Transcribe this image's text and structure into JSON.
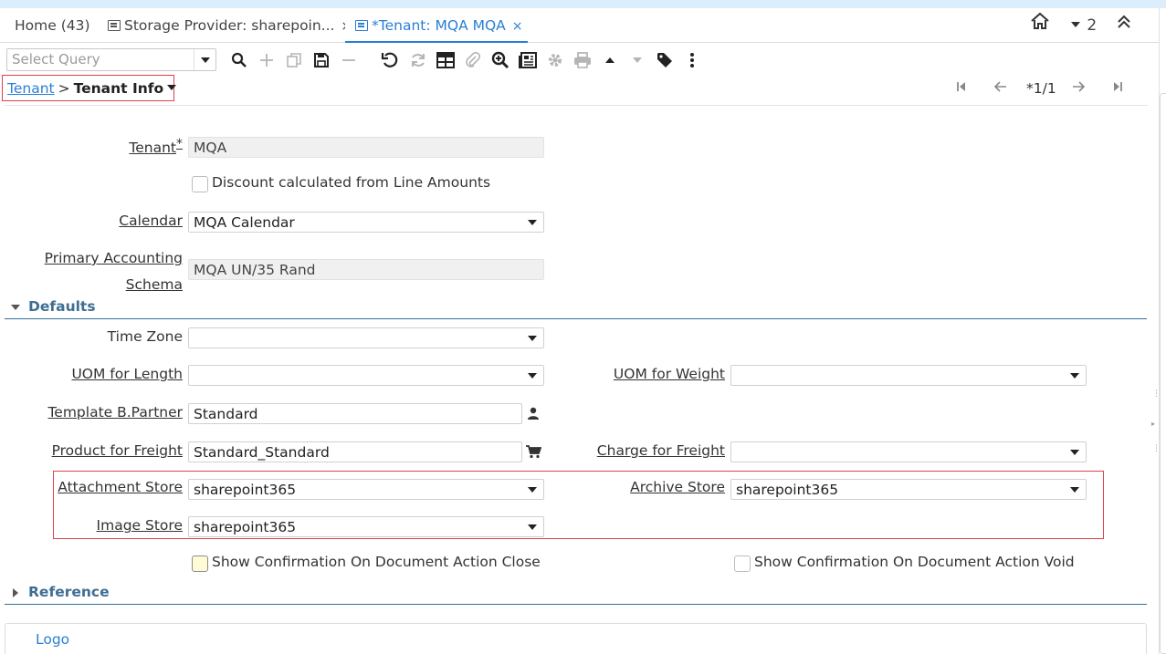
{
  "tabs": [
    {
      "label": "Home (43)"
    },
    {
      "label": "Storage Provider: sharepoin...",
      "close": "×"
    },
    {
      "label": "*Tenant: MQA MQA",
      "close": "×"
    }
  ],
  "header_right": {
    "count": "2"
  },
  "toolbar": {
    "query_placeholder": "Select Query"
  },
  "breadcrumb": {
    "parent": "Tenant",
    "separator": ">",
    "current": "Tenant Info"
  },
  "record_nav": {
    "position": "*1/1"
  },
  "form": {
    "tenant": {
      "label": "Tenant",
      "required": "*",
      "value": "MQA"
    },
    "discount": {
      "label": "Discount calculated from Line Amounts",
      "checked": false
    },
    "calendar": {
      "label": "Calendar",
      "value": "MQA Calendar"
    },
    "schema": {
      "label_line1": "Primary Accounting",
      "label_line2": "Schema",
      "value": "MQA UN/35 Rand"
    }
  },
  "defaults": {
    "title": "Defaults",
    "time_zone": {
      "label": "Time Zone",
      "value": ""
    },
    "uom_length": {
      "label": "UOM for Length",
      "value": ""
    },
    "uom_weight": {
      "label": "UOM for Weight",
      "value": ""
    },
    "template_bp": {
      "label": "Template B.Partner",
      "value": "Standard"
    },
    "product_freight": {
      "label": "Product for Freight",
      "value": "Standard_Standard"
    },
    "charge_freight": {
      "label": "Charge for Freight",
      "value": ""
    },
    "attachment_store": {
      "label": "Attachment Store",
      "value": "sharepoint365"
    },
    "archive_store": {
      "label": "Archive Store",
      "value": "sharepoint365"
    },
    "image_store": {
      "label": "Image Store",
      "value": "sharepoint365"
    },
    "confirm_close": {
      "label": "Show Confirmation On Document Action Close",
      "checked": false
    },
    "confirm_void": {
      "label": "Show Confirmation On Document Action Void",
      "checked": false
    }
  },
  "reference": {
    "title": "Reference"
  },
  "logo": {
    "label": "Logo"
  }
}
